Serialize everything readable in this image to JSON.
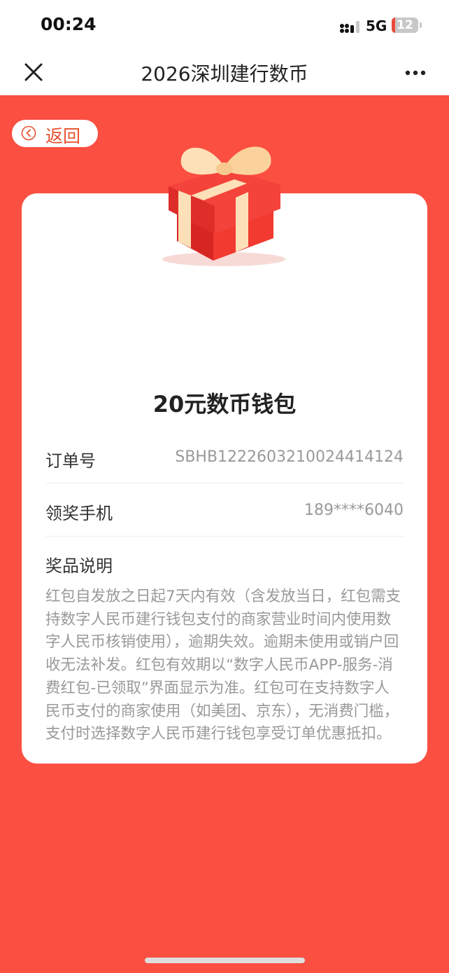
{
  "status_bar": {
    "time": "00:24",
    "network": "5G",
    "battery": "12",
    "icons": [
      "signal-icon",
      "battery-icon"
    ]
  },
  "nav": {
    "title": "2026深圳建行数币",
    "icons": [
      "close-icon",
      "more-icon"
    ]
  },
  "page": {
    "back_label": "返回",
    "card": {
      "title": "20元数币钱包",
      "rows": [
        {
          "label": "订单号",
          "value": "SBHB1222603210024414124"
        },
        {
          "label": "领奖手机",
          "value": "189****6040"
        }
      ],
      "description_title": "奖品说明",
      "description": "红包自发放之日起7天内有效（含发放当日，红包需支持数字人民币建行钱包支付的商家营业时间内使用数字人民币核销使用），逾期失效。逾期未使用或销户回收无法补发。红包有效期以“数字人民币APP-服务-消费红包-已领取”界面显示为准。红包可在支持数字人民币支付的商家使用（如美团、京东），无消费门槛，支付时选择数字人民币建行钱包享受订单优惠抵扣。"
    }
  },
  "colors": {
    "background": "#fa4f41",
    "back_text": "#e8502f",
    "gift_box": "#f23a30",
    "ribbon": "#fde0b8"
  }
}
